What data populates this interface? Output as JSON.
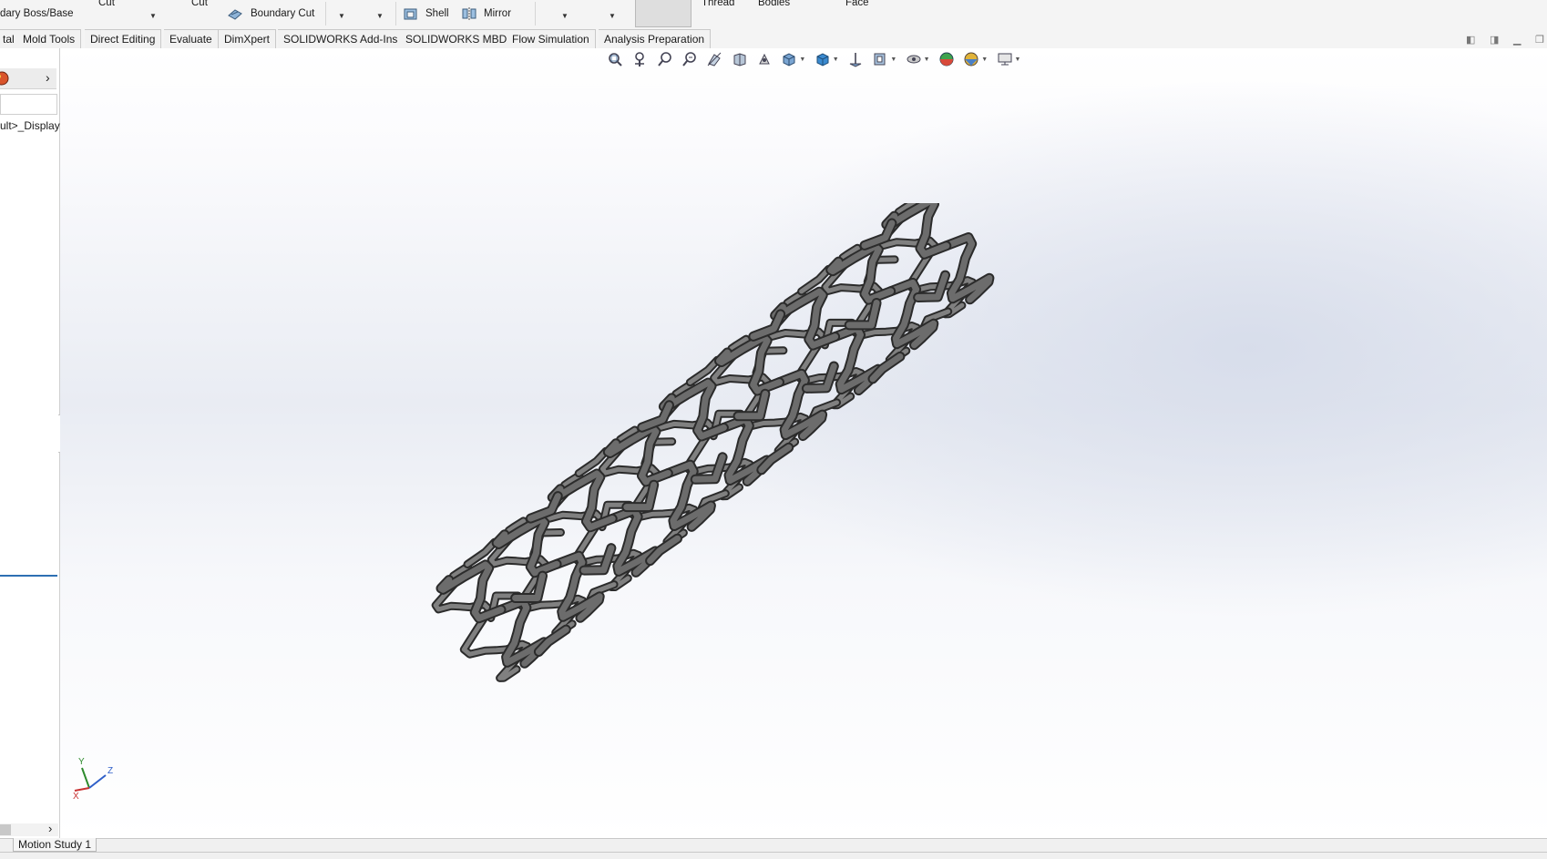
{
  "ribbon": {
    "boss_base_label": "dary Boss/Base",
    "cut_label_1": "Cut",
    "cut_label_2": "Cut",
    "boundary_cut_label": "Boundary Cut",
    "shell_label": "Shell",
    "mirror_label": "Mirror",
    "thread_label": "Thread",
    "bodies_label": "Bodies",
    "face_label": "Face"
  },
  "tabs": [
    {
      "label": "tal"
    },
    {
      "label": "Mold Tools"
    },
    {
      "label": "Direct Editing"
    },
    {
      "label": "Evaluate"
    },
    {
      "label": "DimXpert"
    },
    {
      "label": "SOLIDWORKS Add-Ins"
    },
    {
      "label": "SOLIDWORKS MBD"
    },
    {
      "label": "Flow Simulation"
    },
    {
      "label": "Analysis Preparation"
    }
  ],
  "left_panel": {
    "tree_item": "ult>_Display"
  },
  "triad": {
    "x_label": "X",
    "y_label": "Y",
    "z_label": "Z"
  },
  "bottom": {
    "motion_tab": "Motion Study 1"
  },
  "colors": {
    "stent_fill": "#6c6c6c",
    "stent_edge": "#2b2b2b",
    "accent": "#2d6fb3"
  }
}
